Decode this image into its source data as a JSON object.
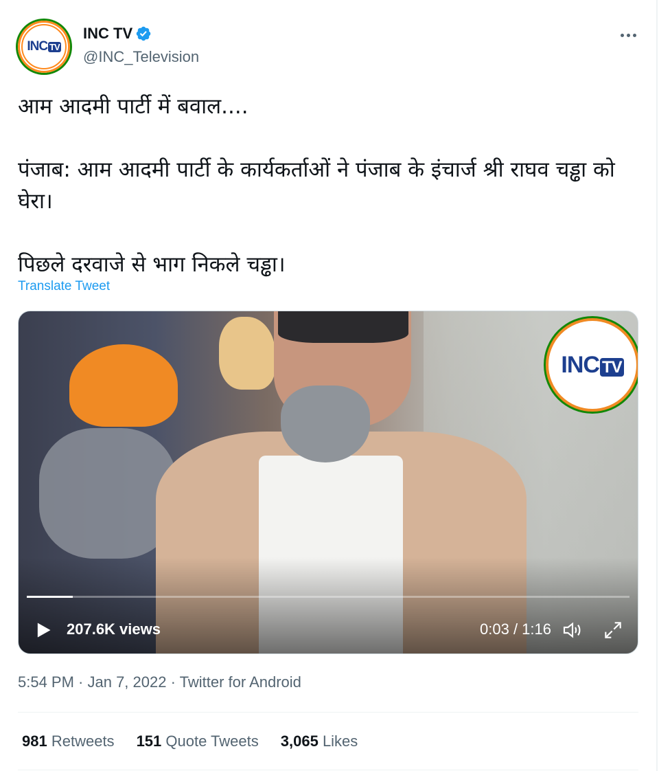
{
  "account": {
    "avatar_text": "INC",
    "avatar_text_tv": "TV",
    "name": "INC TV",
    "handle": "@INC_Television",
    "verified_icon": "verified-badge-icon"
  },
  "tweet": {
    "paragraphs": [
      "आम आदमी पार्टी में बवाल....",
      "पंजाब: आम आदमी पार्टी के कार्यकर्ताओं ने पंजाब के इंचार्ज श्री राघव चड्ढा को घेरा।",
      "पिछले दरवाजे से भाग निकले चड्ढा।"
    ],
    "translate_label": "Translate Tweet"
  },
  "video": {
    "watermark_text": "INC",
    "watermark_text_tv": "TV",
    "views": "207.6K views",
    "time": "0:03 / 1:16",
    "progress": 0.076
  },
  "meta": {
    "timestamp": "5:54 PM · Jan 7, 2022 · Twitter for Android"
  },
  "stats": {
    "retweets_count": "981",
    "retweets_label": "Retweets",
    "quotes_count": "151",
    "quotes_label": "Quote Tweets",
    "likes_count": "3,065",
    "likes_label": "Likes"
  },
  "colors": {
    "link": "#1d9bf0",
    "secondary_text": "#536471",
    "primary_text": "#0f1419"
  }
}
